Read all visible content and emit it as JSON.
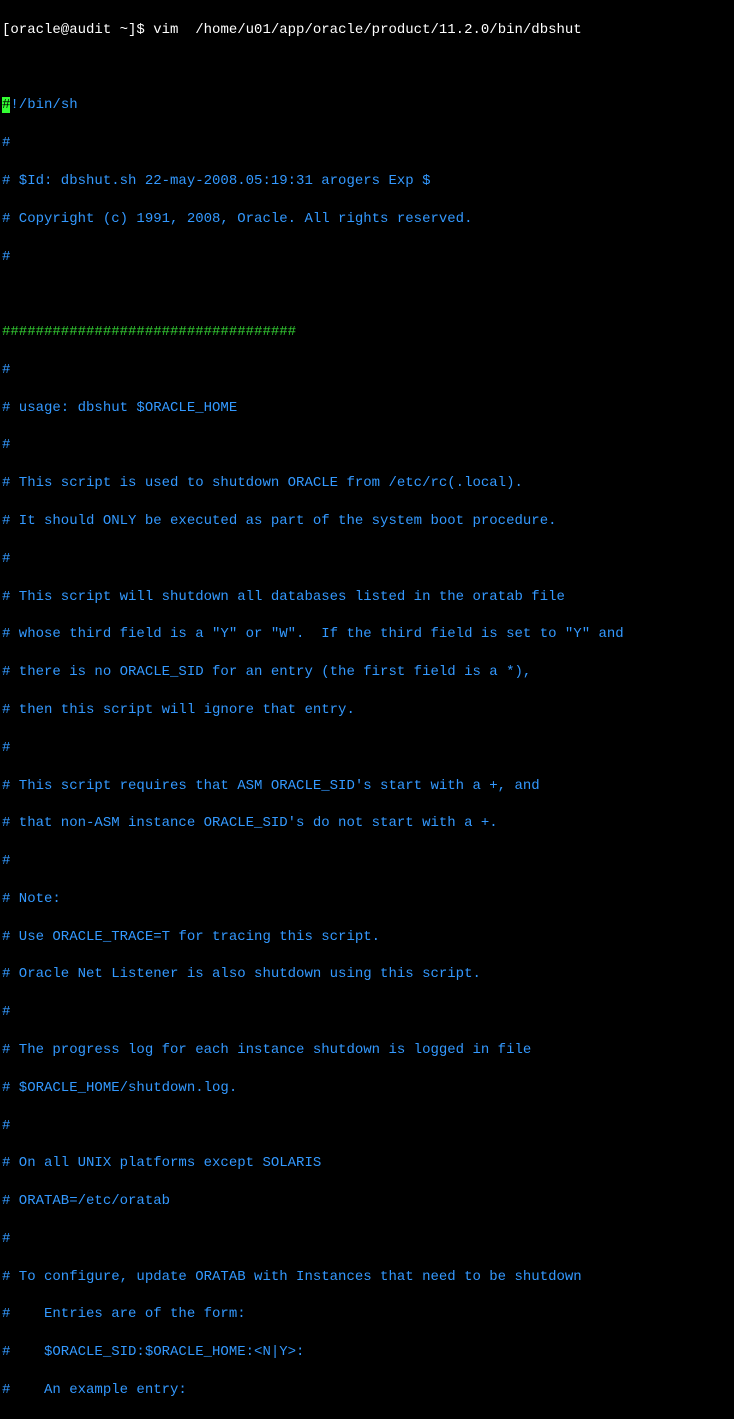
{
  "terminal": {
    "line0_partial": "[oracle@audit ~]$ vim  /home/u01/app/oracle/product/........./bin/......",
    "prompt": "[oracle@audit ~]$ ",
    "command": "vim  /home/u01/app/oracle/product/11.2.0/bin/dbshut",
    "cursor_char": "#",
    "script": {
      "shebang_rest": "!/bin/sh",
      "l1": "#",
      "l2": "# $Id: dbshut.sh 22-may-2008.05:19:31 arogers Exp $",
      "l3": "# Copyright (c) 1991, 2008, Oracle. All rights reserved.",
      "l4": "#",
      "l6": "###################################",
      "l7": "#",
      "l8": "# usage: dbshut $ORACLE_HOME",
      "l9": "#",
      "l10": "# This script is used to shutdown ORACLE from /etc/rc(.local).",
      "l11": "# It should ONLY be executed as part of the system boot procedure.",
      "l12": "#",
      "l13": "# This script will shutdown all databases listed in the oratab file",
      "l14": "# whose third field is a \"Y\" or \"W\".  If the third field is set to \"Y\" and",
      "l15": "# there is no ORACLE_SID for an entry (the first field is a *),",
      "l16": "# then this script will ignore that entry.",
      "l17": "#",
      "l18": "# This script requires that ASM ORACLE_SID's start with a +, and",
      "l19": "# that non-ASM instance ORACLE_SID's do not start with a +.",
      "l20": "#",
      "l21": "# Note:",
      "l22": "# Use ORACLE_TRACE=T for tracing this script.",
      "l23": "# Oracle Net Listener is also shutdown using this script.",
      "l24": "#",
      "l25": "# The progress log for each instance shutdown is logged in file",
      "l26": "# $ORACLE_HOME/shutdown.log.",
      "l27": "#",
      "l28": "# On all UNIX platforms except SOLARIS",
      "l29": "# ORATAB=/etc/oratab",
      "l30": "#",
      "l31": "# To configure, update ORATAB with Instances that need to be shutdown",
      "l32": "#    Entries are of the form:",
      "l33": "#    $ORACLE_SID:$ORACLE_HOME:<N|Y>:",
      "l34": "#    An example entry:"
    }
  }
}
